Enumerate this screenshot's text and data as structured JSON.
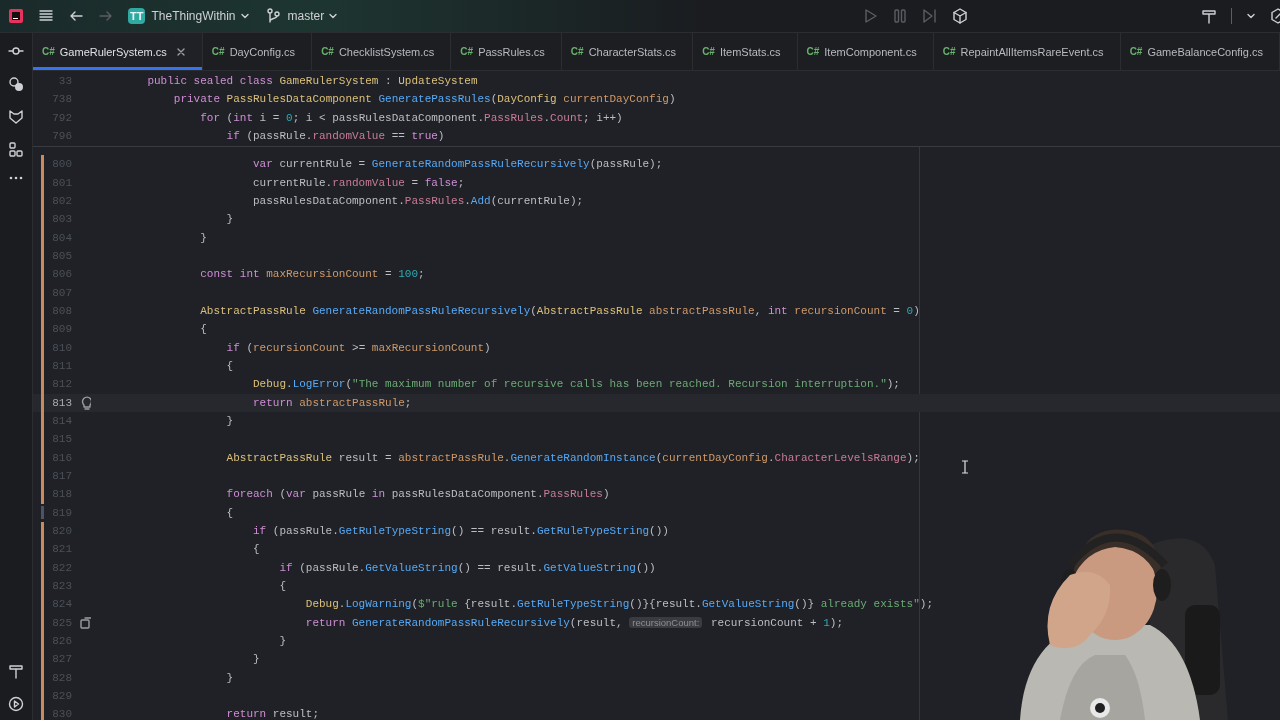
{
  "toolbar": {
    "project": {
      "badge": "TT",
      "name": "TheThingWithin"
    },
    "branch": "master",
    "nav": [
      {
        "kind": "back",
        "disabled": false
      },
      {
        "kind": "forward",
        "disabled": true
      }
    ],
    "run_controls": [
      {
        "kind": "run",
        "disabled": true
      },
      {
        "kind": "pause",
        "disabled": true
      },
      {
        "kind": "step",
        "disabled": true
      },
      {
        "kind": "unity",
        "disabled": false
      }
    ]
  },
  "tabs": [
    {
      "badge": "C#",
      "label": "GameRulerSystem.cs",
      "selected": true
    },
    {
      "badge": "C#",
      "label": "DayConfig.cs",
      "selected": false
    },
    {
      "badge": "C#",
      "label": "ChecklistSystem.cs",
      "selected": false
    },
    {
      "badge": "C#",
      "label": "PassRules.cs",
      "selected": false
    },
    {
      "badge": "C#",
      "label": "CharacterStats.cs",
      "selected": false
    },
    {
      "badge": "C#",
      "label": "ItemStats.cs",
      "selected": false
    },
    {
      "badge": "C#",
      "label": "ItemComponent.cs",
      "selected": false
    },
    {
      "badge": "C#",
      "label": "RepaintAllItemsRareEvent.cs",
      "selected": false
    },
    {
      "badge": "C#",
      "label": "GameBalanceConfig.cs",
      "selected": false
    }
  ],
  "editor": {
    "sticky_lines": [
      {
        "number": "33",
        "tokens": [
          {
            "kind": "k",
            "text": "    public sealed class "
          },
          {
            "kind": "t",
            "text": "GameRulerSystem"
          },
          {
            "kind": "x",
            "text": " : "
          },
          {
            "kind": "t",
            "text": "UpdateSystem"
          }
        ]
      },
      {
        "number": "738",
        "tokens": [
          {
            "kind": "k",
            "text": "        private "
          },
          {
            "kind": "t",
            "text": "PassRulesDataComponent "
          },
          {
            "kind": "m",
            "text": "GeneratePassRules"
          },
          {
            "kind": "x",
            "text": "("
          },
          {
            "kind": "t",
            "text": "DayConfig "
          },
          {
            "kind": "v",
            "text": "currentDayConfig"
          },
          {
            "kind": "x",
            "text": ")"
          }
        ]
      },
      {
        "number": "792",
        "tokens": [
          {
            "kind": "k",
            "text": "            for "
          },
          {
            "kind": "x",
            "text": "("
          },
          {
            "kind": "k",
            "text": "int "
          },
          {
            "kind": "x",
            "text": "i = "
          },
          {
            "kind": "n",
            "text": "0"
          },
          {
            "kind": "x",
            "text": "; i < passRulesDataComponent."
          },
          {
            "kind": "p",
            "text": "PassRules"
          },
          {
            "kind": "x",
            "text": "."
          },
          {
            "kind": "p",
            "text": "Count"
          },
          {
            "kind": "x",
            "text": "; i++)"
          }
        ]
      },
      {
        "number": "796",
        "tokens": [
          {
            "kind": "k",
            "text": "                if "
          },
          {
            "kind": "x",
            "text": "(passRule."
          },
          {
            "kind": "p",
            "text": "randomValue"
          },
          {
            "kind": "x",
            "text": " == "
          },
          {
            "kind": "k",
            "text": "true"
          },
          {
            "kind": "x",
            "text": ")"
          }
        ]
      }
    ],
    "lines": [
      {
        "number": "800",
        "current": false,
        "modified": true,
        "tokens": [
          {
            "kind": "k",
            "text": "                    var "
          },
          {
            "kind": "x",
            "text": "currentRule = "
          },
          {
            "kind": "m",
            "text": "GenerateRandomPassRuleRecursively"
          },
          {
            "kind": "x",
            "text": "(passRule);"
          }
        ]
      },
      {
        "number": "801",
        "current": false,
        "modified": true,
        "tokens": [
          {
            "kind": "x",
            "text": "                    currentRule."
          },
          {
            "kind": "p",
            "text": "randomValue"
          },
          {
            "kind": "x",
            "text": " = "
          },
          {
            "kind": "k",
            "text": "false"
          },
          {
            "kind": "x",
            "text": ";"
          }
        ]
      },
      {
        "number": "802",
        "current": false,
        "modified": true,
        "tokens": [
          {
            "kind": "x",
            "text": "                    passRulesDataComponent."
          },
          {
            "kind": "p",
            "text": "PassRules"
          },
          {
            "kind": "x",
            "text": "."
          },
          {
            "kind": "m",
            "text": "Add"
          },
          {
            "kind": "x",
            "text": "(currentRule);"
          }
        ]
      },
      {
        "number": "803",
        "current": false,
        "modified": true,
        "tokens": [
          {
            "kind": "x",
            "text": "                }"
          }
        ]
      },
      {
        "number": "804",
        "current": false,
        "modified": true,
        "tokens": [
          {
            "kind": "x",
            "text": "            }"
          }
        ]
      },
      {
        "number": "805",
        "current": false,
        "modified": true
      },
      {
        "number": "806",
        "current": false,
        "modified": true,
        "tokens": [
          {
            "kind": "k",
            "text": "            const int "
          },
          {
            "kind": "v",
            "text": "maxRecursionCount"
          },
          {
            "kind": "x",
            "text": " = "
          },
          {
            "kind": "n",
            "text": "100"
          },
          {
            "kind": "x",
            "text": ";"
          }
        ]
      },
      {
        "number": "807",
        "current": false,
        "modified": true
      },
      {
        "number": "808",
        "current": false,
        "modified": true,
        "tokens": [
          {
            "kind": "t",
            "text": "            AbstractPassRule "
          },
          {
            "kind": "m",
            "text": "GenerateRandomPassRuleRecursively"
          },
          {
            "kind": "x",
            "text": "("
          },
          {
            "kind": "t",
            "text": "AbstractPassRule "
          },
          {
            "kind": "v",
            "text": "abstractPassRule"
          },
          {
            "kind": "x",
            "text": ", "
          },
          {
            "kind": "k",
            "text": "int "
          },
          {
            "kind": "v",
            "text": "recursionCount"
          },
          {
            "kind": "x",
            "text": " = "
          },
          {
            "kind": "n",
            "text": "0"
          },
          {
            "kind": "x",
            "text": ")"
          }
        ]
      },
      {
        "number": "809",
        "current": false,
        "modified": true,
        "tokens": [
          {
            "kind": "x",
            "text": "            {"
          }
        ]
      },
      {
        "number": "810",
        "current": false,
        "modified": true,
        "tokens": [
          {
            "kind": "k",
            "text": "                if "
          },
          {
            "kind": "x",
            "text": "("
          },
          {
            "kind": "v",
            "text": "recursionCount"
          },
          {
            "kind": "x",
            "text": " >= "
          },
          {
            "kind": "v",
            "text": "maxRecursionCount"
          },
          {
            "kind": "x",
            "text": ")"
          }
        ]
      },
      {
        "number": "811",
        "current": false,
        "modified": true,
        "tokens": [
          {
            "kind": "x",
            "text": "                {"
          }
        ]
      },
      {
        "number": "812",
        "current": false,
        "modified": true,
        "tokens": [
          {
            "kind": "t",
            "text": "                    Debug"
          },
          {
            "kind": "x",
            "text": "."
          },
          {
            "kind": "m",
            "text": "LogError"
          },
          {
            "kind": "x",
            "text": "("
          },
          {
            "kind": "s",
            "text": "\"The maximum number of recursive calls has been reached. Recursion interruption.\""
          },
          {
            "kind": "x",
            "text": ");"
          }
        ]
      },
      {
        "number": "813",
        "current": true,
        "modified": true,
        "gutter": {
          "kind": "bulb"
        },
        "tokens": [
          {
            "kind": "k",
            "text": "                    return "
          },
          {
            "kind": "v",
            "text": "abstractPassRule"
          },
          {
            "kind": "x",
            "text": ";"
          }
        ]
      },
      {
        "number": "814",
        "current": false,
        "modified": true,
        "tokens": [
          {
            "kind": "x",
            "text": "                }"
          }
        ]
      },
      {
        "number": "815",
        "current": false,
        "modified": true
      },
      {
        "number": "816",
        "current": false,
        "modified": true,
        "tokens": [
          {
            "kind": "t",
            "text": "                AbstractPassRule "
          },
          {
            "kind": "x",
            "text": "result = "
          },
          {
            "kind": "v",
            "text": "abstractPassRule"
          },
          {
            "kind": "x",
            "text": "."
          },
          {
            "kind": "m",
            "text": "GenerateRandomInstance"
          },
          {
            "kind": "x",
            "text": "("
          },
          {
            "kind": "v",
            "text": "currentDayConfig"
          },
          {
            "kind": "x",
            "text": "."
          },
          {
            "kind": "p",
            "text": "CharacterLevelsRange"
          },
          {
            "kind": "x",
            "text": ");"
          }
        ]
      },
      {
        "number": "817",
        "current": false,
        "modified": true
      },
      {
        "number": "818",
        "current": false,
        "modified": true,
        "tokens": [
          {
            "kind": "k",
            "text": "                foreach "
          },
          {
            "kind": "x",
            "text": "("
          },
          {
            "kind": "k",
            "text": "var "
          },
          {
            "kind": "x",
            "text": "passRule "
          },
          {
            "kind": "k",
            "text": "in "
          },
          {
            "kind": "x",
            "text": "passRulesDataComponent."
          },
          {
            "kind": "p",
            "text": "PassRules"
          },
          {
            "kind": "x",
            "text": ")"
          }
        ]
      },
      {
        "number": "819",
        "current": false,
        "modified": false,
        "tokens": [
          {
            "kind": "x",
            "text": "                {"
          }
        ]
      },
      {
        "number": "820",
        "current": false,
        "modified": true,
        "tokens": [
          {
            "kind": "k",
            "text": "                    if "
          },
          {
            "kind": "x",
            "text": "(passRule."
          },
          {
            "kind": "m",
            "text": "GetRuleTypeString"
          },
          {
            "kind": "x",
            "text": "() == result."
          },
          {
            "kind": "m",
            "text": "GetRuleTypeString"
          },
          {
            "kind": "x",
            "text": "())"
          }
        ]
      },
      {
        "number": "821",
        "current": false,
        "modified": true,
        "tokens": [
          {
            "kind": "x",
            "text": "                    {"
          }
        ]
      },
      {
        "number": "822",
        "current": false,
        "modified": true,
        "tokens": [
          {
            "kind": "k",
            "text": "                        if "
          },
          {
            "kind": "x",
            "text": "(passRule."
          },
          {
            "kind": "m",
            "text": "GetValueString"
          },
          {
            "kind": "x",
            "text": "() == result."
          },
          {
            "kind": "m",
            "text": "GetValueString"
          },
          {
            "kind": "x",
            "text": "())"
          }
        ]
      },
      {
        "number": "823",
        "current": false,
        "modified": true,
        "tokens": [
          {
            "kind": "x",
            "text": "                        {"
          }
        ]
      },
      {
        "number": "824",
        "current": false,
        "modified": true,
        "tokens": [
          {
            "kind": "t",
            "text": "                            Debug"
          },
          {
            "kind": "x",
            "text": "."
          },
          {
            "kind": "m",
            "text": "LogWarning"
          },
          {
            "kind": "x",
            "text": "("
          },
          {
            "kind": "s",
            "text": "$\"rule "
          },
          {
            "kind": "x",
            "text": "{result."
          },
          {
            "kind": "m",
            "text": "GetRuleTypeString"
          },
          {
            "kind": "x",
            "text": "()}{result."
          },
          {
            "kind": "m",
            "text": "GetValueString"
          },
          {
            "kind": "x",
            "text": "()}"
          },
          {
            "kind": "s",
            "text": " already exists\""
          },
          {
            "kind": "x",
            "text": ");"
          }
        ]
      },
      {
        "number": "825",
        "current": false,
        "modified": true,
        "gutter": {
          "kind": "override"
        },
        "tokens": [
          {
            "kind": "k",
            "text": "                            return "
          },
          {
            "kind": "m",
            "text": "GenerateRandomPassRuleRecursively"
          },
          {
            "kind": "x",
            "text": "(result, "
          },
          {
            "kind": "h",
            "text": "recursionCount:"
          },
          {
            "kind": "x",
            "text": " recursionCount + "
          },
          {
            "kind": "n",
            "text": "1"
          },
          {
            "kind": "x",
            "text": ");"
          }
        ]
      },
      {
        "number": "826",
        "current": false,
        "modified": true,
        "tokens": [
          {
            "kind": "x",
            "text": "                        }"
          }
        ]
      },
      {
        "number": "827",
        "current": false,
        "modified": true,
        "tokens": [
          {
            "kind": "x",
            "text": "                    }"
          }
        ]
      },
      {
        "number": "828",
        "current": false,
        "modified": true,
        "tokens": [
          {
            "kind": "x",
            "text": "                }"
          }
        ]
      },
      {
        "number": "829",
        "current": false,
        "modified": true
      },
      {
        "number": "830",
        "current": false,
        "modified": true,
        "tokens": [
          {
            "kind": "k",
            "text": "                return "
          },
          {
            "kind": "x",
            "text": "result;"
          }
        ]
      }
    ]
  }
}
